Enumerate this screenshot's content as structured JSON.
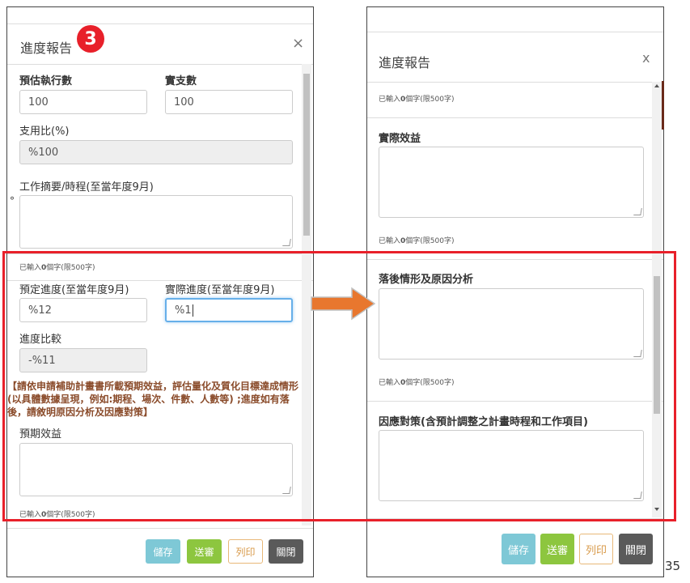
{
  "left": {
    "title": "進度報告",
    "step_badge": "3",
    "close": "×",
    "est_exec_label": "預估執行數",
    "est_exec_value": "100",
    "actual_label": "實支數",
    "actual_value": "100",
    "ratio_label": "支用比(%)",
    "ratio_value": "%100",
    "summary_label": "工作摘要/時程(至當年度9月)",
    "stray_mark": "°",
    "counter1_pre": "已輸入",
    "counter1_num": "0",
    "counter1_post": "個字(限500字)",
    "planned_label": "預定進度(至當年度9月)",
    "planned_value": "%12",
    "real_label": "實際進度(至當年度9月)",
    "real_value": "%1",
    "compare_label": "進度比較",
    "compare_value": "-%11",
    "note": "【請依申請補助計畫書所載預期效益，評估量化及質化目標達成情形(以具體數據呈現，例如:期程、場次、件數、人數等) ;進度如有落後，請敘明原因分析及因應對策】",
    "expected_label": "預期效益",
    "counter2_pre": "已輸入",
    "counter2_num": "0",
    "counter2_post": "個字(限500字)",
    "buttons": {
      "save": "儲存",
      "send": "送審",
      "print": "列印",
      "close": "關閉"
    }
  },
  "right": {
    "title": "進度報告",
    "close": "x",
    "counter_top_pre": "已輸入",
    "counter_top_num": "0",
    "counter_top_post": "個字(限500字)",
    "actual_benefit_label": "實際效益",
    "counter_a_pre": "已輸入",
    "counter_a_num": "0",
    "counter_a_post": "個字(限500字)",
    "delay_label": "落後情形及原因分析",
    "counter_b_pre": "已輸入",
    "counter_b_num": "0",
    "counter_b_post": "個字(限500字)",
    "response_label": "因應對策(含預計調整之計畫時程和工作項目)",
    "buttons": {
      "save": "儲存",
      "send": "送審",
      "print": "列印",
      "close": "關閉"
    }
  },
  "page_number": "35",
  "colors": {
    "save": "#7ec8d6",
    "send": "#8dc63f",
    "print_border": "#e8b878",
    "print_text": "#d89a4a",
    "close": "#5a5a5a",
    "highlight": "#e8202a",
    "arrow": "#e8772e",
    "badge": "#e8202a"
  }
}
